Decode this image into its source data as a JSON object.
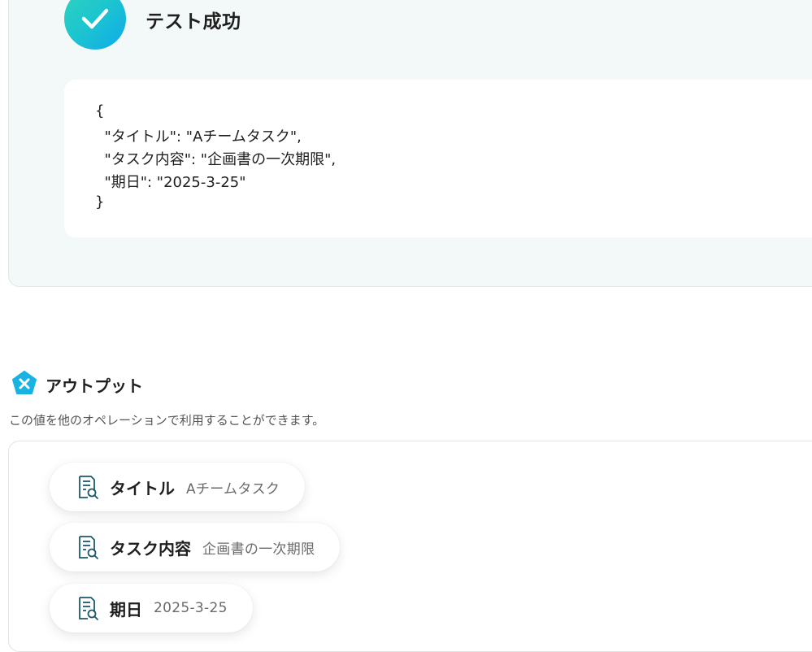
{
  "test": {
    "title": "テスト成功",
    "json_lines": [
      "{",
      "  \"タイトル\": \"Aチームタスク\",",
      "  \"タスク内容\": \"企画書の一次期限\",",
      "  \"期日\": \"2025-3-25\"",
      "}"
    ]
  },
  "output": {
    "icon": "x-pentagon-icon",
    "title": "アウトプット",
    "description": "この値を他のオペレーションで利用することができます。",
    "items": [
      {
        "label": "タイトル",
        "value": "Aチームタスク"
      },
      {
        "label": "タスク内容",
        "value": "企画書の一次期限"
      },
      {
        "label": "期日",
        "value": "2025-3-25"
      }
    ]
  },
  "colors": {
    "accent_gradient_start": "#2fd3bf",
    "accent_gradient_end": "#10a9ec",
    "panel_bg": "#f2f9f8",
    "icon_teal": "#1b5a6a"
  }
}
